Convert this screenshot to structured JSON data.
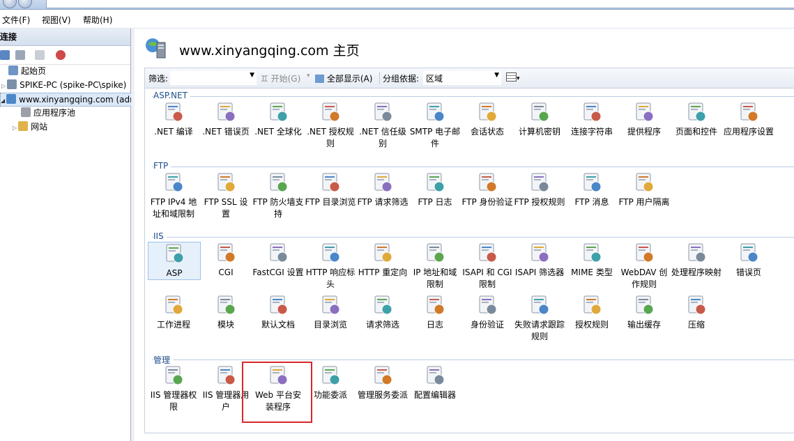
{
  "menu": {
    "file": "文件(F)",
    "view": "视图(V)",
    "help": "帮助(H)"
  },
  "left_pane": {
    "header": "连接",
    "tree": [
      {
        "label": "起始页"
      },
      {
        "label": "SPIKE-PC (spike-PC\\spike)"
      },
      {
        "label": "www.xinyangqing.com (adr"
      },
      {
        "label": "应用程序池"
      },
      {
        "label": "网站"
      }
    ]
  },
  "main": {
    "title": "www.xinyangqing.com 主页",
    "filter": {
      "label": "筛选:",
      "go": "开始(G)",
      "show_all": "全部显示(A)",
      "group_by_label": "分组依据:",
      "group_by_value": "区域"
    },
    "groups": [
      {
        "name": "ASP.NET",
        "items": [
          {
            "label": ".NET 编译",
            "icon": "net-compile-icon"
          },
          {
            "label": ".NET 错误页",
            "icon": "net-error-pages-icon"
          },
          {
            "label": ".NET 全球化",
            "icon": "net-globalization-icon"
          },
          {
            "label": ".NET 授权规则",
            "icon": "net-authorization-rules-icon"
          },
          {
            "label": ".NET 信任级别",
            "icon": "net-trust-levels-icon"
          },
          {
            "label": "SMTP 电子邮件",
            "icon": "smtp-email-icon"
          },
          {
            "label": "会话状态",
            "icon": "session-state-icon"
          },
          {
            "label": "计算机密钥",
            "icon": "machine-key-icon"
          },
          {
            "label": "连接字符串",
            "icon": "connection-strings-icon"
          },
          {
            "label": "提供程序",
            "icon": "providers-icon"
          },
          {
            "label": "页面和控件",
            "icon": "pages-controls-icon"
          },
          {
            "label": "应用程序设置",
            "icon": "application-settings-icon"
          }
        ]
      },
      {
        "name": "FTP",
        "items": [
          {
            "label": "FTP IPv4 地址和域限制",
            "icon": "ftp-ip-restrictions-icon"
          },
          {
            "label": "FTP SSL 设置",
            "icon": "ftp-ssl-icon"
          },
          {
            "label": "FTP 防火墙支持",
            "icon": "ftp-firewall-icon"
          },
          {
            "label": "FTP 目录浏览",
            "icon": "ftp-directory-browsing-icon"
          },
          {
            "label": "FTP 请求筛选",
            "icon": "ftp-request-filtering-icon"
          },
          {
            "label": "FTP 日志",
            "icon": "ftp-logging-icon"
          },
          {
            "label": "FTP 身份验证",
            "icon": "ftp-authentication-icon"
          },
          {
            "label": "FTP 授权规则",
            "icon": "ftp-authorization-icon"
          },
          {
            "label": "FTP 消息",
            "icon": "ftp-messages-icon"
          },
          {
            "label": "FTP 用户隔离",
            "icon": "ftp-user-isolation-icon"
          }
        ]
      },
      {
        "name": "IIS",
        "items": [
          {
            "label": "ASP",
            "icon": "asp-icon"
          },
          {
            "label": "CGI",
            "icon": "cgi-icon"
          },
          {
            "label": "FastCGI 设置",
            "icon": "fastcgi-icon"
          },
          {
            "label": "HTTP 响应标头",
            "icon": "http-response-headers-icon"
          },
          {
            "label": "HTTP 重定向",
            "icon": "http-redirect-icon"
          },
          {
            "label": "IP 地址和域限制",
            "icon": "ip-restrictions-icon"
          },
          {
            "label": "ISAPI 和 CGI 限制",
            "icon": "isapi-cgi-restrictions-icon"
          },
          {
            "label": "ISAPI 筛选器",
            "icon": "isapi-filters-icon"
          },
          {
            "label": "MIME 类型",
            "icon": "mime-types-icon"
          },
          {
            "label": "WebDAV 创作规则",
            "icon": "webdav-icon"
          },
          {
            "label": "处理程序映射",
            "icon": "handler-mappings-icon"
          },
          {
            "label": "错误页",
            "icon": "error-pages-icon"
          },
          {
            "label": "工作进程",
            "icon": "worker-processes-icon"
          },
          {
            "label": "模块",
            "icon": "modules-icon"
          },
          {
            "label": "默认文档",
            "icon": "default-document-icon"
          },
          {
            "label": "目录浏览",
            "icon": "directory-browsing-icon"
          },
          {
            "label": "请求筛选",
            "icon": "request-filtering-icon"
          },
          {
            "label": "日志",
            "icon": "logging-icon"
          },
          {
            "label": "身份验证",
            "icon": "authentication-icon"
          },
          {
            "label": "失败请求跟踪规则",
            "icon": "failed-request-tracing-icon"
          },
          {
            "label": "授权规则",
            "icon": "authorization-rules-icon"
          },
          {
            "label": "输出缓存",
            "icon": "output-caching-icon"
          },
          {
            "label": "压缩",
            "icon": "compression-icon"
          }
        ]
      },
      {
        "name": "管理",
        "items": [
          {
            "label": "IIS 管理器权限",
            "icon": "iis-manager-permissions-icon"
          },
          {
            "label": "IIS 管理器用户",
            "icon": "iis-manager-users-icon"
          },
          {
            "label": "Web 平台安装程序",
            "icon": "web-platform-installer-icon"
          },
          {
            "label": "功能委派",
            "icon": "feature-delegation-icon"
          },
          {
            "label": "管理服务委派",
            "icon": "management-service-delegation-icon"
          },
          {
            "label": "配置编辑器",
            "icon": "configuration-editor-icon"
          }
        ]
      }
    ]
  },
  "colors": {
    "group_label": "#1f4d8c",
    "highlight_box": "#d9262b",
    "selection": "#e6f0fb"
  }
}
